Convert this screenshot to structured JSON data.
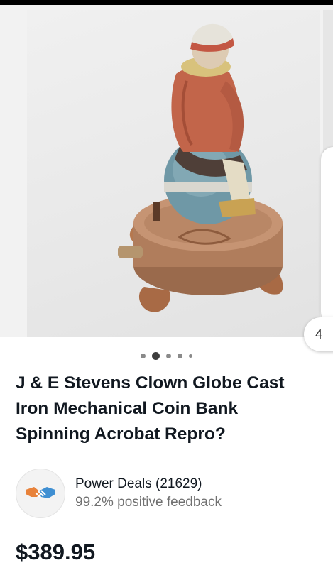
{
  "gallery": {
    "image_counter": "4",
    "dots_total": 5,
    "dots_active_index": 1
  },
  "listing": {
    "title": "J & E Stevens Clown Globe Cast\nIron Mechanical Coin Bank\nSpinning Acrobat Repro?",
    "price": "$389.95"
  },
  "seller": {
    "name": "Power Deals (21629)",
    "feedback": "99.2% positive feedback",
    "avatar_icon": "handshake-icon"
  },
  "colors": {
    "text": "#111820",
    "muted": "#707070",
    "handshake_left": "#e8823a",
    "handshake_right": "#3f8fd2"
  }
}
